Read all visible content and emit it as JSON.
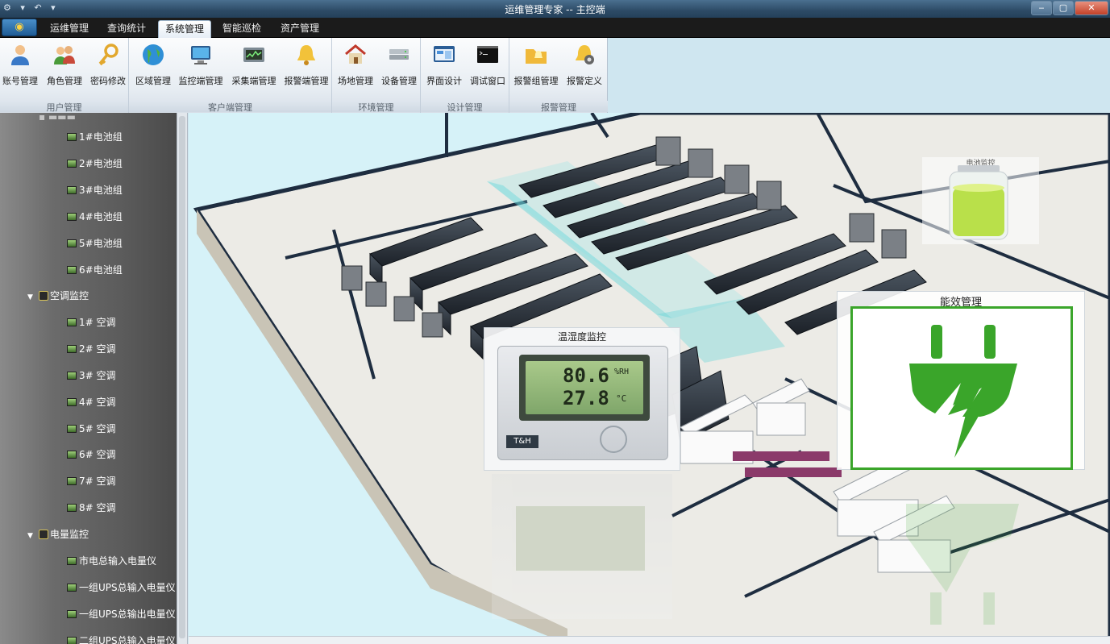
{
  "window": {
    "title": "运维管理专家 -- 主控端",
    "quick_access": "⚙ ▾ ↶ ▾",
    "controls": [
      "‒",
      "▢",
      "✕"
    ]
  },
  "menu": {
    "tabs": [
      "运维管理",
      "查询统计",
      "系统管理",
      "智能巡检",
      "资产管理"
    ],
    "active_tab": "系统管理"
  },
  "ribbon": {
    "groups": [
      {
        "caption": "用户管理",
        "buttons": [
          "账号管理",
          "角色管理",
          "密码修改"
        ]
      },
      {
        "caption": "客户端管理",
        "buttons": [
          "区域管理",
          "监控端管理",
          "采集端管理",
          "报警端管理"
        ]
      },
      {
        "caption": "环境管理",
        "buttons": [
          "场地管理",
          "设备管理"
        ]
      },
      {
        "caption": "设计管理",
        "buttons": [
          "界面设计",
          "调试窗口"
        ]
      },
      {
        "caption": "报警管理",
        "buttons": [
          "报警组管理",
          "报警定义"
        ]
      }
    ]
  },
  "tree": {
    "battery_items": [
      "1#电池组",
      "2#电池组",
      "3#电池组",
      "4#电池组",
      "5#电池组",
      "6#电池组"
    ],
    "ac_category": "空调监控",
    "ac_items": [
      "1# 空调",
      "2# 空调",
      "3# 空调",
      "4# 空调",
      "5# 空调",
      "6# 空调",
      "7# 空调",
      "8# 空调"
    ],
    "power_category": "电量监控",
    "power_items": [
      "市电总输入电量仪",
      "一组UPS总输入电量仪",
      "一组UPS总输出电量仪",
      "二组UPS总输入电量仪"
    ]
  },
  "overlays": {
    "battery_title": "电池监控",
    "energy_title": "能效管理",
    "temp_title": "温湿度监控",
    "temp_humidity": "80.6",
    "temp_humidity_unit": "%RH",
    "temp_value": "27.8",
    "temp_unit": "°C",
    "brand": "T&H"
  },
  "colors": {
    "energy_green": "#3aa52a",
    "battery_green": "#b9e04a"
  }
}
